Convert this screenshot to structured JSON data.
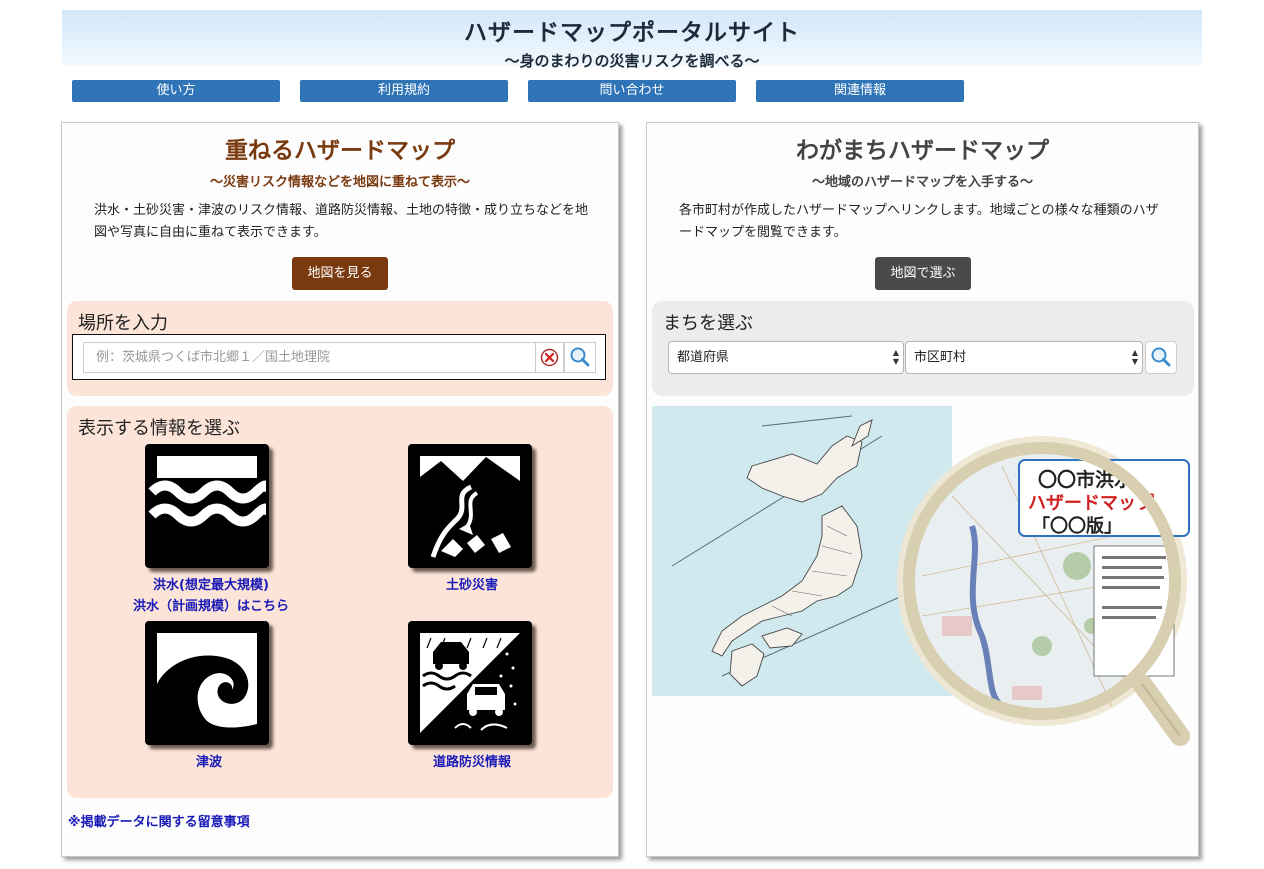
{
  "header": {
    "title": "ハザードマップポータルサイト",
    "subtitle": "〜身のまわりの災害リスクを調べる〜"
  },
  "nav": [
    "使い方",
    "利用規約",
    "問い合わせ",
    "関連情報"
  ],
  "left_panel": {
    "title": "重ねるハザードマップ",
    "subtitle": "〜災害リスク情報などを地図に重ねて表示〜",
    "description": "洪水・土砂災害・津波のリスク情報、道路防災情報、土地の特徴・成り立ちなどを地図や写真に自由に重ねて表示できます。",
    "button": "地図を見る",
    "search": {
      "label": "場所を入力",
      "placeholder": "例：茨城県つくば市北郷１／国土地理院"
    },
    "layers": {
      "label": "表示する情報を選ぶ",
      "flood_label": "洪水(想定最大規模)",
      "flood_plan_label": "洪水（計画規模）はこちら",
      "landslide_label": "土砂災害",
      "tsunami_label": "津波",
      "road_label": "道路防災情報"
    },
    "note": "※掲載データに関する留意事項"
  },
  "right_panel": {
    "title": "わがまちハザードマップ",
    "subtitle": "〜地域のハザードマップを入手する〜",
    "description": "各市町村が作成したハザードマップへリンクします。地域ごとの様々な種類のハザードマップを閲覧できます。",
    "button": "地図で選ぶ",
    "select_box": {
      "label": "まちを選ぶ",
      "prefecture": "都道府県",
      "municipality": "市区町村"
    },
    "magnifier_text": {
      "line1": "〇〇市洪水",
      "line2": "ハザードマップ",
      "line3": "「〇〇版」"
    }
  },
  "colors": {
    "nav": "#3074b8",
    "left_accent": "#7a3a10",
    "left_box": "#fce5d8",
    "right_box": "#ececec",
    "right_title": "#444444",
    "link": "#1a1ab8"
  }
}
